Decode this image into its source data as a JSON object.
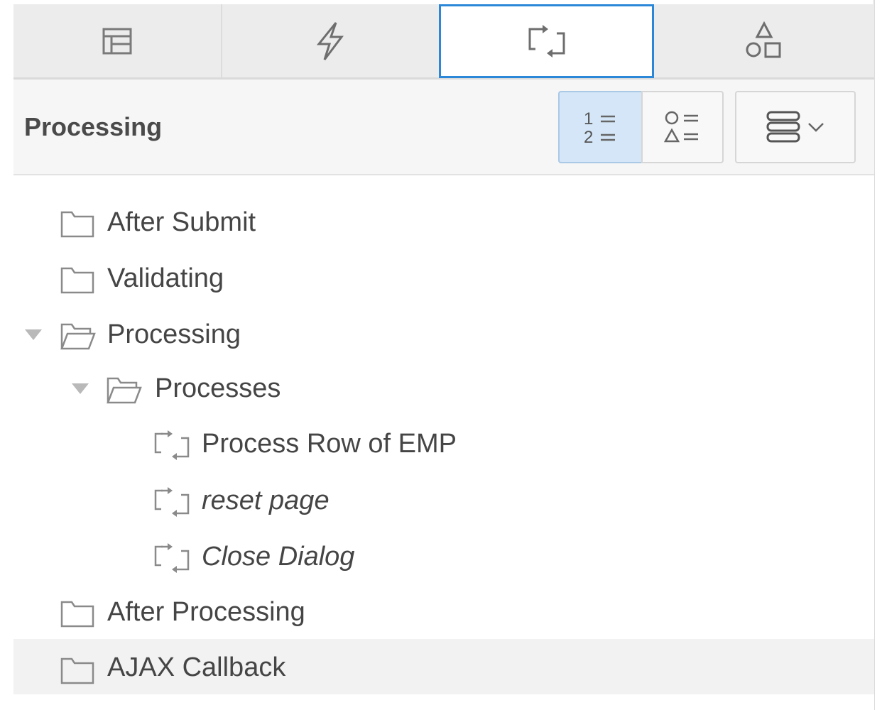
{
  "tabs": [
    {
      "icon": "layout-grid-icon",
      "active": false
    },
    {
      "icon": "lightning-icon",
      "active": false
    },
    {
      "icon": "process-arrows-icon",
      "active": true
    },
    {
      "icon": "shapes-icon",
      "active": false
    }
  ],
  "header": {
    "title": "Processing",
    "view_buttons": [
      {
        "icon": "numbered-list-icon",
        "selected": true
      },
      {
        "icon": "component-list-icon",
        "selected": false
      }
    ],
    "menu_button": {
      "icon": "stack-menu-icon"
    }
  },
  "tree": [
    {
      "label": "After Submit",
      "kind": "folder",
      "expanded": false,
      "italic": false
    },
    {
      "label": "Validating",
      "kind": "folder",
      "expanded": false,
      "italic": false
    },
    {
      "label": "Processing",
      "kind": "folder",
      "expanded": true,
      "italic": false
    },
    {
      "label": "Processes",
      "kind": "folder",
      "expanded": true,
      "italic": false
    },
    {
      "label": "Process Row of EMP",
      "kind": "process",
      "italic": false
    },
    {
      "label": "reset page",
      "kind": "process",
      "italic": true
    },
    {
      "label": "Close Dialog",
      "kind": "process",
      "italic": true
    },
    {
      "label": "After Processing",
      "kind": "folder",
      "expanded": false,
      "italic": false
    },
    {
      "label": "AJAX Callback",
      "kind": "folder",
      "expanded": false,
      "italic": false,
      "selected": true
    }
  ],
  "colors": {
    "accent": "#2b88d8",
    "selected_button_bg": "#d4e6f7",
    "tab_bg": "#ececec",
    "text": "#454545",
    "icon": "#7a7a7a"
  }
}
